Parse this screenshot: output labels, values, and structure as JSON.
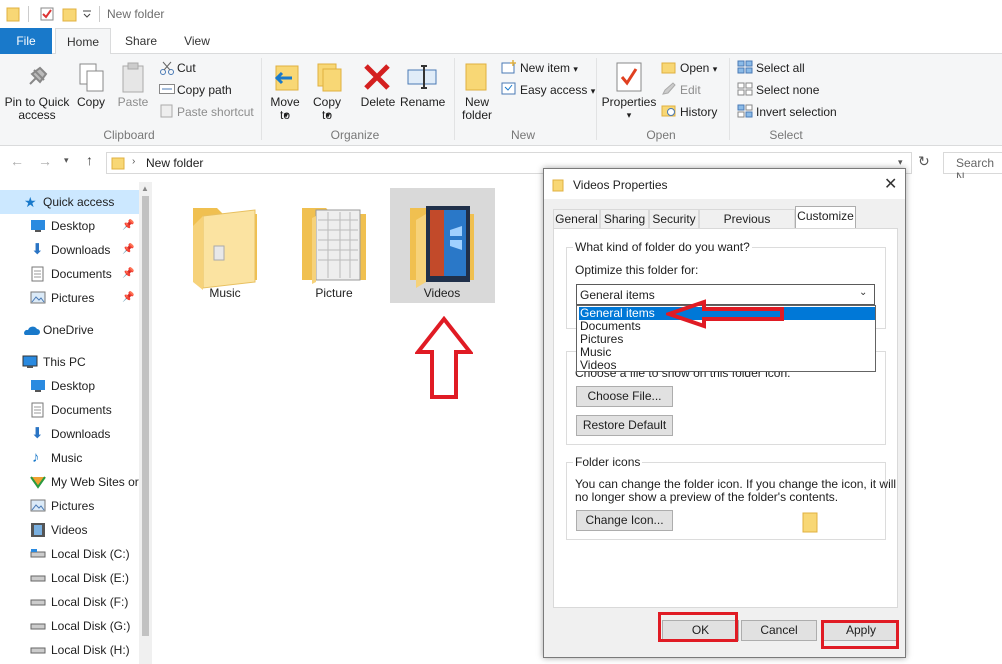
{
  "window": {
    "title": "New folder"
  },
  "ribbon_tabs": [
    "File",
    "Home",
    "Share",
    "View"
  ],
  "clipboard": {
    "pin_label": "Pin to Quick access",
    "copy_label": "Copy",
    "paste_label": "Paste",
    "cut_label": "Cut",
    "copy_path_label": "Copy path",
    "paste_shortcut_label": "Paste shortcut",
    "group_label": "Clipboard"
  },
  "organize": {
    "move_to_label": "Move to",
    "copy_to_label": "Copy to",
    "delete_label": "Delete",
    "rename_label": "Rename",
    "group_label": "Organize"
  },
  "new": {
    "new_folder_label": "New folder",
    "new_item_label": "New item",
    "easy_access_label": "Easy access",
    "group_label": "New"
  },
  "open": {
    "properties_label": "Properties",
    "open_label": "Open",
    "edit_label": "Edit",
    "history_label": "History",
    "group_label": "Open"
  },
  "select": {
    "select_all_label": "Select all",
    "select_none_label": "Select none",
    "invert_label": "Invert selection",
    "group_label": "Select"
  },
  "address": {
    "path": "New folder",
    "search_placeholder": "Search N"
  },
  "nav": {
    "quick_access": "Quick access",
    "qa_items": [
      "Desktop",
      "Downloads",
      "Documents",
      "Pictures"
    ],
    "onedrive": "OneDrive",
    "this_pc": "This PC",
    "pc_items": [
      "Desktop",
      "Documents",
      "Downloads",
      "Music",
      "My Web Sites or",
      "Pictures",
      "Videos",
      "Local Disk (C:)",
      "Local Disk (E:)",
      "Local Disk (F:)",
      "Local Disk (G:)",
      "Local Disk (H:)"
    ]
  },
  "folders": [
    "Music",
    "Picture",
    "Videos"
  ],
  "dialog": {
    "title": "Videos Properties",
    "tabs": [
      "General",
      "Sharing",
      "Security",
      "Previous Versions",
      "Customize"
    ],
    "question": "What kind of folder do you want?",
    "optimize_label": "Optimize this folder for:",
    "selected": "General items",
    "options": [
      "General items",
      "Documents",
      "Pictures",
      "Music",
      "Videos"
    ],
    "pictures_hint": "Choose a file to show on this folder icon.",
    "choose_file": "Choose File...",
    "restore_default": "Restore Default",
    "folder_icons_legend": "Folder icons",
    "folder_icons_text_1": "You can change the folder icon. If you change the icon, it will",
    "folder_icons_text_2": "no longer show a preview of the folder's contents.",
    "change_icon": "Change Icon...",
    "ok": "OK",
    "cancel": "Cancel",
    "apply": "Apply"
  },
  "colors": {
    "accent": "#1979ca",
    "annotation": "#e01b24",
    "selection": "#cce8ff",
    "folder": "#f8d775"
  }
}
